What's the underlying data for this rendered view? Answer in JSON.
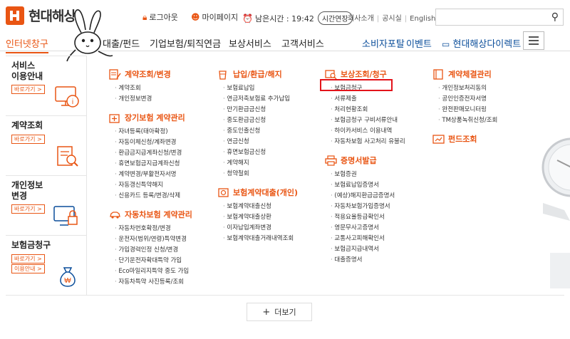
{
  "brand": {
    "name": "현대해상",
    "color": "#e95513"
  },
  "util": {
    "logout": "로그아웃",
    "mypage": "마이페이지",
    "timer_label": "남은시간 : 19:42",
    "extend": "시간연장",
    "links": [
      "회사소개",
      "공시실",
      "English"
    ]
  },
  "gnb": {
    "items": [
      "인터넷창구",
      "대출/펀드",
      "기업보험/퇴직연금",
      "보상서비스",
      "고객서비스"
    ],
    "right": [
      "소비자포탈",
      "이벤트",
      "현대해상다이렉트"
    ]
  },
  "side": [
    {
      "title1": "서비스",
      "title2": "이용안내",
      "btn": "바로가기 >"
    },
    {
      "title1": "계약조회",
      "title2": "",
      "btn": "바로가기 >"
    },
    {
      "title1": "개인정보",
      "title2": "변경",
      "btn": "바로가기 >"
    },
    {
      "title1": "보험금청구",
      "title2": "",
      "btn": "바로가기 >",
      "btn2": "이용안내 >"
    }
  ],
  "col1": {
    "s1": {
      "head": "계약조회/변경",
      "items": [
        "계약조회",
        "개인정보변경"
      ]
    },
    "s2": {
      "head": "장기보험 계약관리",
      "items": [
        "자녀등록(태아확정)",
        "자동이체신청/계좌변경",
        "환급금지급계좌신청/변경",
        "휴면보험금지급계좌신청",
        "계약변경/부활전자서명",
        "자동갱신특약해지",
        "신용카드 등록/변경/삭제"
      ]
    },
    "s3": {
      "head": "자동차보험 계약관리",
      "items": [
        "자동차번호확정/변경",
        "운전자(범위/연령)특약변경",
        "가입경력인정 신청/변경",
        "단기운전자확대특약 가입",
        "Eco마일리지특약 중도 가입",
        "자동차특약 사진등록/조회"
      ]
    }
  },
  "col2": {
    "s1": {
      "head": "납입/환급/해지",
      "items": [
        "보험료납입",
        "연금저축보험료 추가납입",
        "만기환급금신청",
        "중도환급금신청",
        "중도인출신청",
        "연금신청",
        "휴면보험금신청",
        "계약해지",
        "청약철회"
      ]
    },
    "s2": {
      "head": "보험계약대출(개인)",
      "items": [
        "보험계약대출신청",
        "보험계약대출상환",
        "이자납입계좌변경",
        "보험계약대출거래내역조회"
      ]
    }
  },
  "col3": {
    "s1": {
      "head": "보상조회/청구",
      "items": [
        "보험금청구",
        "서류제출",
        "처리현황조회",
        "보험금청구 구비서류안내",
        "하이카서비스 이용내역",
        "자동차보험 사고처리 유불리"
      ]
    },
    "s2": {
      "head": "증명서발급",
      "items": [
        "보험증권",
        "보험료납입증명서",
        "(예상)해지환급금증명서",
        "자동차보험가입증명서",
        "적용요율등급확인서",
        "영문무사고증명서",
        "교통사고피해확인서",
        "보험금지급내역서",
        "대출증명서"
      ]
    }
  },
  "col4": {
    "s1": {
      "head": "계약체결관리",
      "items": [
        "개인정보처리동의",
        "공인인증전자서명",
        "완전판매모니터링",
        "TM상품녹취신청/조회"
      ]
    },
    "s2": {
      "head": "펀드조회"
    }
  },
  "more": {
    "label": "더보기"
  }
}
